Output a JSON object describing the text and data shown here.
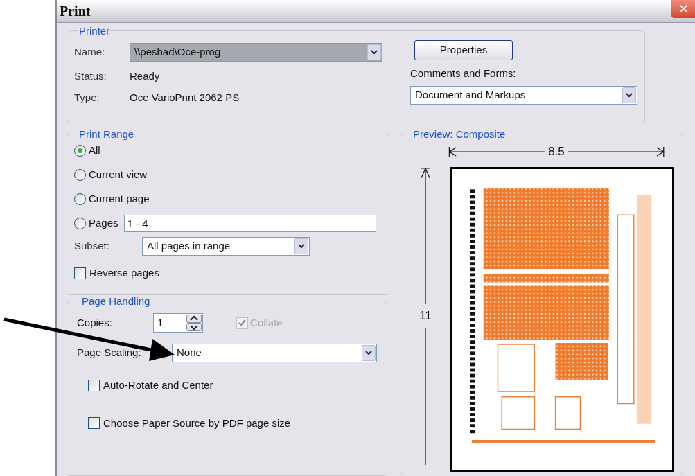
{
  "window": {
    "title": "Print",
    "close": "✕"
  },
  "printer": {
    "group_label": "Printer",
    "name_label": "Name:",
    "name_value": "\\\\pesbad\\Oce-prog",
    "status_label": "Status:",
    "status_value": "Ready",
    "type_label": "Type:",
    "type_value": "Oce VarioPrint 2062 PS",
    "properties_button": "Properties",
    "comments_label": "Comments and Forms:",
    "comments_value": "Document and Markups"
  },
  "print_range": {
    "group_label": "Print Range",
    "options": [
      {
        "label": "All",
        "selected": true
      },
      {
        "label": "Current view",
        "selected": false
      },
      {
        "label": "Current page",
        "selected": false
      },
      {
        "label": "Pages",
        "selected": false
      }
    ],
    "pages_value": "1 - 4",
    "subset_label": "Subset:",
    "subset_value": "All pages in range",
    "reverse": {
      "label": "Reverse pages",
      "checked": false
    }
  },
  "page_handling": {
    "group_label": "Page Handling",
    "copies_label": "Copies:",
    "copies_value": "1",
    "collate": {
      "label": "Collate",
      "checked": true,
      "disabled": true
    },
    "scaling_label": "Page Scaling:",
    "scaling_value": "None",
    "checkboxes": [
      {
        "label": "Auto-Rotate and Center",
        "checked": false
      },
      {
        "label": "Choose Paper Source by PDF page size",
        "checked": false
      }
    ]
  },
  "preview": {
    "group_label": "Preview: Composite",
    "width_label": "8.5",
    "height_label": "11"
  }
}
